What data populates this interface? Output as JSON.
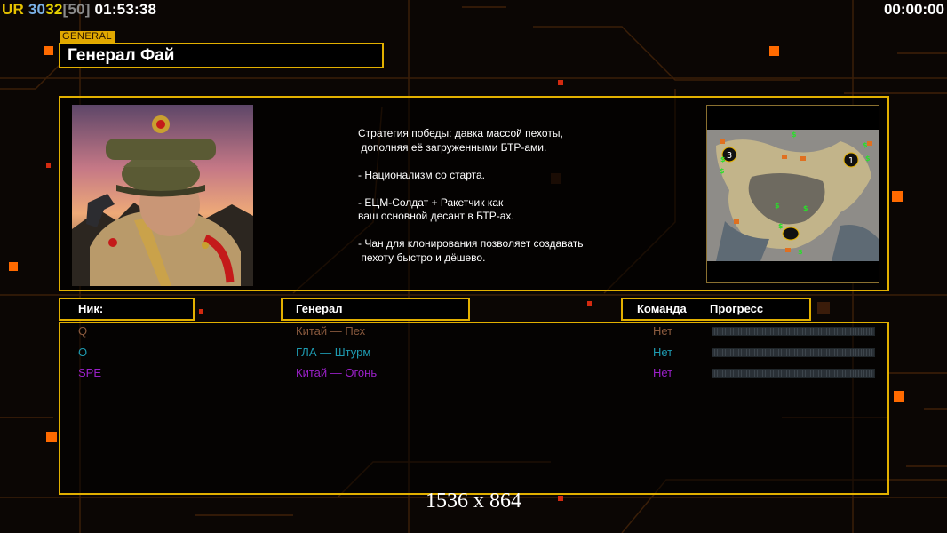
{
  "hud": {
    "ur": "UR",
    "fps_a": "30",
    "fps_b": "32",
    "fps_cap": "[50]",
    "clock": "01:53:38",
    "game_timer": "00:00:00"
  },
  "general": {
    "tag": "GENERAL",
    "name": "Генерал Фай"
  },
  "strategy": {
    "lines": [
      "Стратегия победы: давка массой пехоты,",
      " дополняя её загруженными БТР-ами.",
      "",
      "- Национализм со старта.",
      "",
      "- ЕЦМ-Солдат + Ракетчик как",
      "ваш основной десант в БТР-ах.",
      "",
      "- Чан для клонирования позволяет создавать",
      " пехоту быстро и дёшево."
    ]
  },
  "minimap": {
    "start_labels": [
      "3",
      "1"
    ],
    "cash_symbol": "$"
  },
  "headers": {
    "nick": "Ник:",
    "general": "Генерал",
    "team": "Команда",
    "progress": "Прогресс"
  },
  "players": [
    {
      "nick": "Q",
      "general": "Китай — Пех",
      "team": "Нет",
      "color": "#8a5a3e",
      "progress": 0
    },
    {
      "nick": "O",
      "general": "ГЛА — Штурм",
      "team": "Нет",
      "color": "#1e9ab0",
      "progress": 0
    },
    {
      "nick": "SPE",
      "general": "Китай — Огонь",
      "team": "Нет",
      "color": "#9a20c8",
      "progress": 0
    }
  ],
  "overlay": {
    "resolution": "1536 x 864"
  },
  "colors": {
    "frame": "#e2b000",
    "accent_orange": "#ff6a00"
  }
}
